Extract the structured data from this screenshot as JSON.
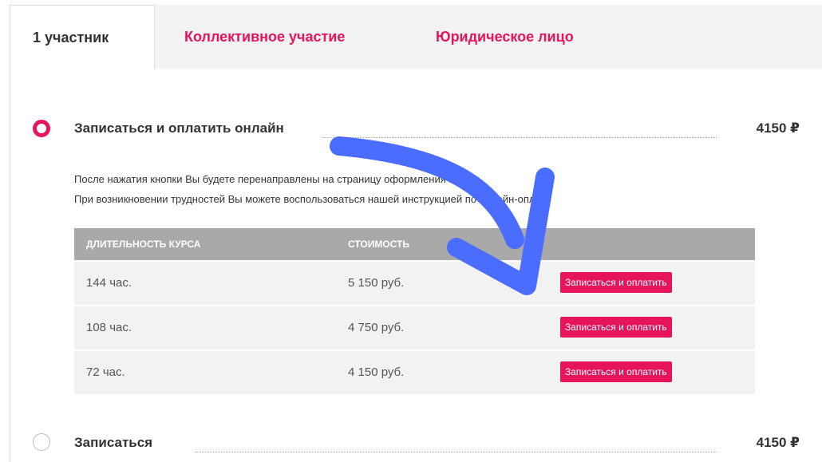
{
  "tabs": [
    {
      "label": "1 участник"
    },
    {
      "label": "Коллективное участие"
    },
    {
      "label": "Юридическое лицо"
    }
  ],
  "option_online": {
    "title": "Записаться и оплатить онлайн",
    "price": "4150 ₽",
    "selected": true
  },
  "description": {
    "line1": "После нажатия кнопки Вы будете перенаправлены на страницу оформления заказа.",
    "line2": "При возникновении трудностей Вы можете воспользоваться нашей инструкцией по онлайн-оплате"
  },
  "table": {
    "headers": [
      "ДЛИТЕЛЬНОСТЬ КУРСА",
      "СТОИМОСТЬ"
    ],
    "rows": [
      {
        "duration": "144 час.",
        "price": "5 150 руб.",
        "button": "Записаться и оплатить"
      },
      {
        "duration": "108 час.",
        "price": "4 750 руб.",
        "button": "Записаться и оплатить"
      },
      {
        "duration": "72 час.",
        "price": "4 150 руб.",
        "button": "Записаться и оплатить"
      }
    ]
  },
  "option_signup": {
    "title": "Записаться",
    "price": "4150 ₽",
    "selected": false
  },
  "colors": {
    "accent": "#e5145b",
    "arrow": "#4a6cff",
    "table_header": "#a9a9a9"
  },
  "overlay": {
    "icon": "curved-arrow-icon"
  }
}
